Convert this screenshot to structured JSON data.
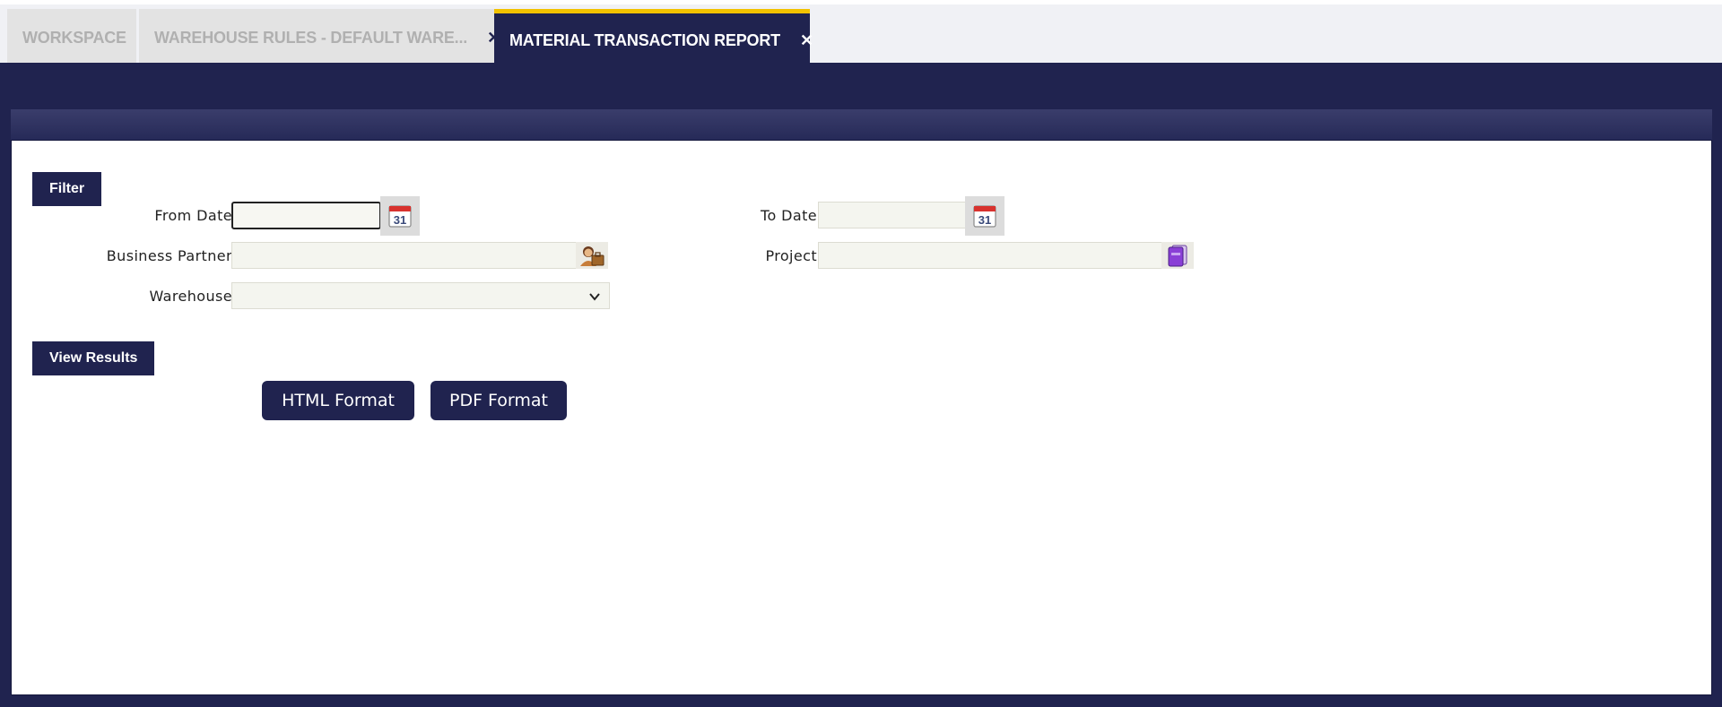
{
  "tabs": [
    {
      "label": "WORKSPACE",
      "closable": false,
      "active": false
    },
    {
      "label": "WAREHOUSE RULES - DEFAULT WARE...",
      "closable": true,
      "active": false
    },
    {
      "label": "MATERIAL TRANSACTION REPORT",
      "closable": true,
      "active": true
    }
  ],
  "tab_close_glyph": "✕",
  "filter_section": {
    "label": "Filter"
  },
  "form": {
    "from_date": {
      "label": "From Date",
      "value": ""
    },
    "to_date": {
      "label": "To Date",
      "value": ""
    },
    "business_partner": {
      "label": "Business Partner",
      "value": ""
    },
    "project": {
      "label": "Project",
      "value": ""
    },
    "warehouse": {
      "label": "Warehouse",
      "value": ""
    },
    "calendar_day": "31"
  },
  "results_section": {
    "label": "View Results"
  },
  "buttons": {
    "html_format": "HTML Format",
    "pdf_format": "PDF Format"
  },
  "colors": {
    "primary": "#20234f",
    "accent": "#f2c200",
    "field_bg": "#f4f5ef"
  },
  "icons": [
    "calendar-icon",
    "business-partner-icon",
    "project-icon",
    "chevron-down-icon",
    "close-icon"
  ]
}
